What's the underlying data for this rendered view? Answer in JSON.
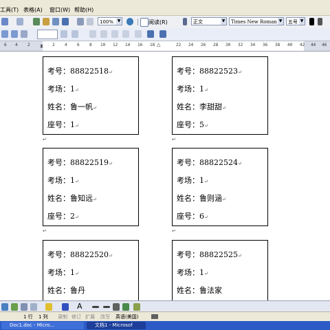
{
  "menu": {
    "tools": "工具(T)",
    "table": "表格(A)",
    "window": "窗口(W)",
    "help": "帮助(H)"
  },
  "toolbar": {
    "zoom": "100%",
    "read": "阅读(R)"
  },
  "format": {
    "style": "正文",
    "font": "Times New Roman",
    "size": "五号"
  },
  "ruler": {
    "ticks": [
      "6",
      "4",
      "2",
      "",
      "2",
      "4",
      "6",
      "8",
      "10",
      "12",
      "14",
      "16",
      "18",
      "",
      "22",
      "24",
      "26",
      "28",
      "30",
      "32",
      "34",
      "36",
      "38",
      "40",
      "42",
      "44",
      "46"
    ]
  },
  "cards": [
    {
      "exam_no": "考号：88822518",
      "room": "考场：1",
      "name": "姓名：鲁一帆",
      "seat": "座号：1"
    },
    {
      "exam_no": "考号：88822523",
      "room": "考场：1",
      "name": "姓名：李甜甜",
      "seat": "座号：5"
    },
    {
      "exam_no": "考号：88822519",
      "room": "考场：1",
      "name": "姓名：鲁知远",
      "seat": "座号：2"
    },
    {
      "exam_no": "考号：88822524",
      "room": "考场：1",
      "name": "姓名：鲁则涵",
      "seat": "座号：6"
    },
    {
      "exam_no": "考号：88822520",
      "room": "考场：1",
      "name": "姓名：鲁丹"
    },
    {
      "exam_no": "考号：88822525",
      "room": "考场：1",
      "name": "姓名：鲁法家"
    }
  ],
  "paragraph_mark": "↵",
  "status": {
    "line": "1 行",
    "col": "1 列",
    "rec": "录制",
    "trk": "修订",
    "ext": "扩展",
    "ovr": "改写",
    "lang": "英语(美国)"
  },
  "taskbar": {
    "task1": "Doc1.doc - Micro...",
    "task2": "文档1 - Microsof"
  },
  "colors": {
    "menubar": "#ece9d8",
    "taskbar": "#2c5bc8",
    "card_border": "#000000"
  }
}
